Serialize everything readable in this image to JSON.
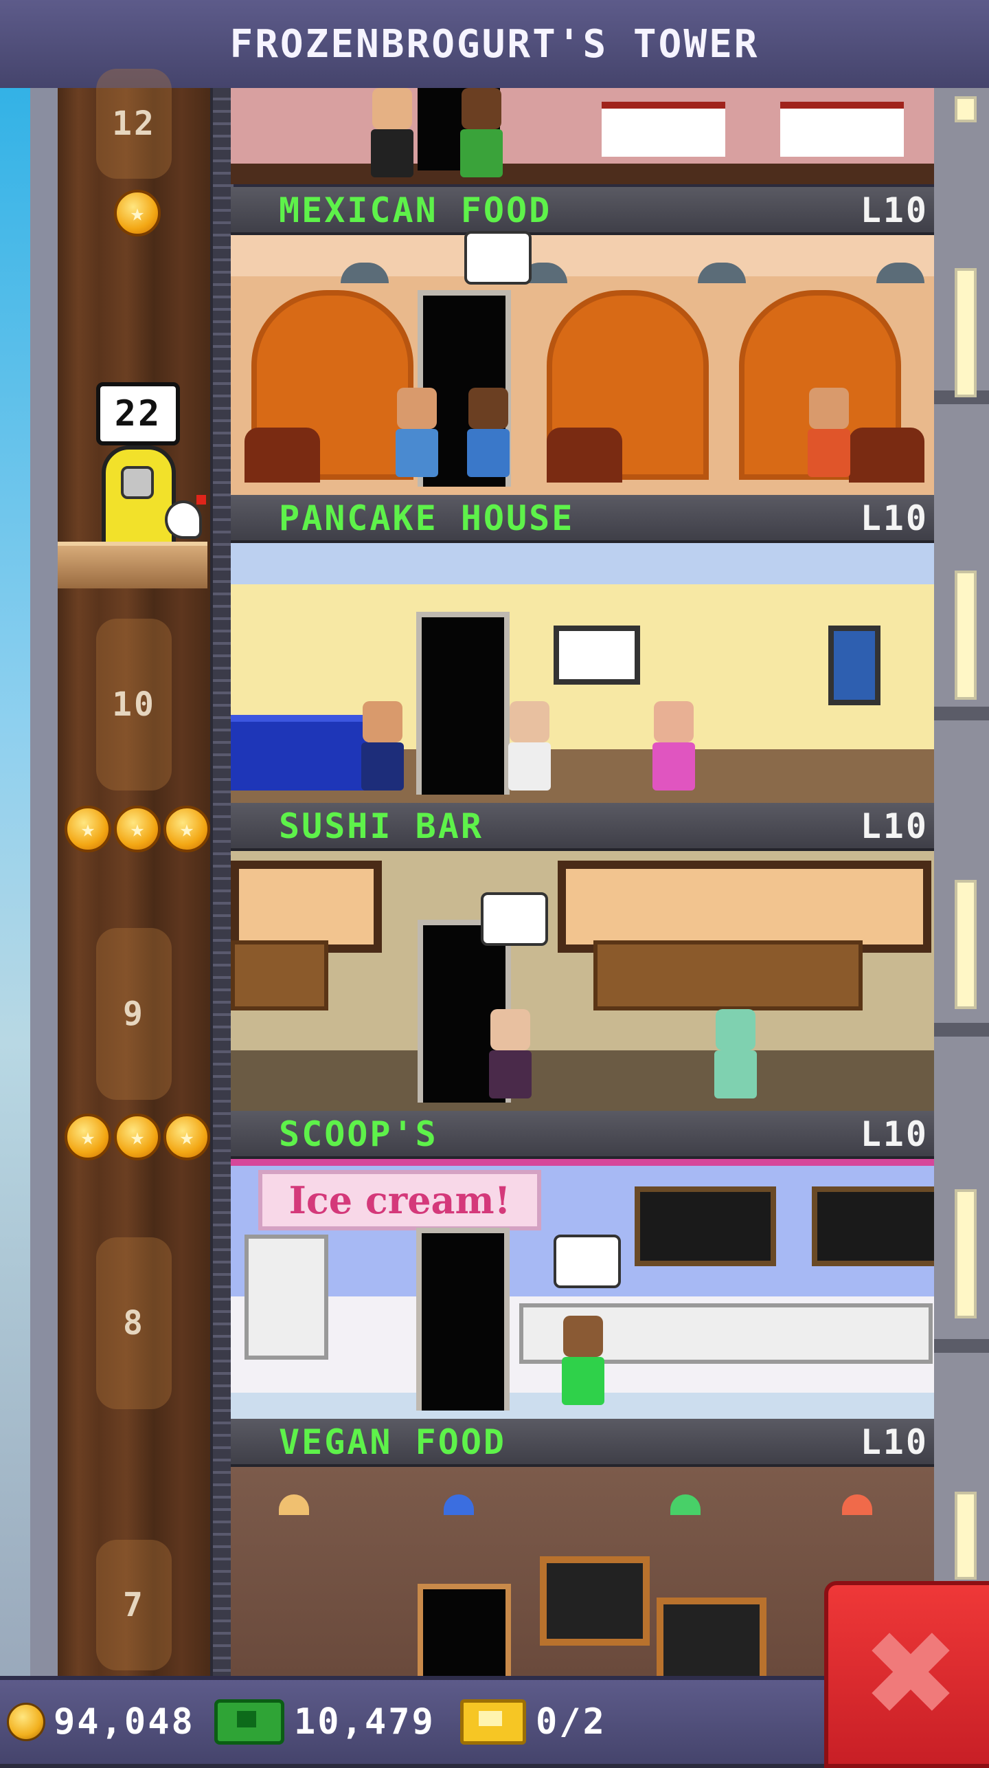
{
  "header": {
    "title": "FROZENBROGURT'S TOWER"
  },
  "elevator": {
    "floor_labels": [
      "12",
      "10",
      "9",
      "8",
      "7"
    ],
    "rider_destination": "22"
  },
  "floors": [
    {
      "name": "MEXICAN FOOD",
      "level": "L10"
    },
    {
      "name": "PANCAKE HOUSE",
      "level": "L10"
    },
    {
      "name": "SUSHI BAR",
      "level": "L10"
    },
    {
      "name": "SCOOP'S",
      "level": "L10"
    },
    {
      "name": "VEGAN FOOD",
      "level": "L10"
    }
  ],
  "scoops_sign": "Ice cream!",
  "status_bar": {
    "coins": "94,048",
    "bux": "10,479",
    "tickets": "0/2"
  },
  "close_button": {
    "label": "✖"
  },
  "colors": {
    "floor_name": "#5ef24a",
    "header_bg": "#55537f",
    "close_red": "#e02a2f"
  }
}
